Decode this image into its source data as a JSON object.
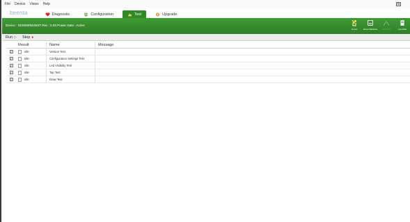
{
  "menubar": {
    "items": [
      "File",
      "Device",
      "Views",
      "Help"
    ],
    "window_button": "⊟"
  },
  "navbar": {
    "logo": "beenta",
    "tabs": [
      {
        "label": "Diagnostic",
        "icon": "heart-icon",
        "active": false
      },
      {
        "label": "Configuration",
        "icon": "config-icon",
        "active": false
      },
      {
        "label": "Test",
        "icon": "test-icon",
        "active": true
      },
      {
        "label": "Upgrade",
        "icon": "upgrade-icon",
        "active": false
      }
    ]
  },
  "devicebar": {
    "info": "Device : SDW090M2MST Rev : 5.00 Power state : Active",
    "actions": [
      {
        "label": "Import",
        "icon": "import-icon",
        "enabled": true
      },
      {
        "label": "Reset Baseline",
        "icon": "reset-icon",
        "enabled": true
      },
      {
        "label": "Get Data",
        "icon": "getdata-icon",
        "enabled": false
      },
      {
        "label": "Log Data",
        "icon": "logdata-icon",
        "enabled": true
      }
    ]
  },
  "toolbar": {
    "run_label": "Run",
    "stop_label": "Stop"
  },
  "grid": {
    "columns": {
      "result": "Result",
      "name": "Name",
      "message": "Message"
    },
    "rows": [
      {
        "checked": true,
        "result": "Idle",
        "name": "Version Test",
        "message": ""
      },
      {
        "checked": true,
        "result": "Idle",
        "name": "Configuration Settings Test",
        "message": ""
      },
      {
        "checked": true,
        "result": "Idle",
        "name": "Led Visibility Test",
        "message": ""
      },
      {
        "checked": true,
        "result": "Idle",
        "name": "Tap Test",
        "message": ""
      },
      {
        "checked": true,
        "result": "Idle",
        "name": "Draw Test",
        "message": ""
      }
    ]
  },
  "colors": {
    "accent_green": "#2e8b26",
    "logo_blue": "#9ab0c9",
    "stop_red": "#d02020"
  }
}
